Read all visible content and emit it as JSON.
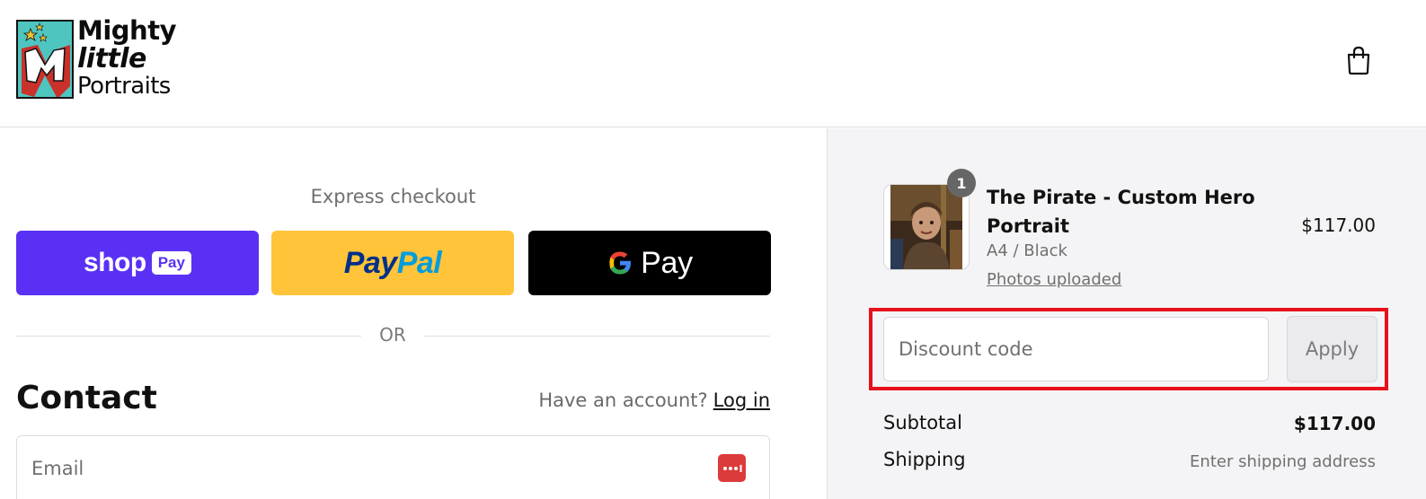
{
  "header": {
    "logo": {
      "line1": "Mighty",
      "line2": "little",
      "line3": "Portraits"
    },
    "cart_icon": "shopping-bag-icon"
  },
  "express": {
    "title": "Express checkout",
    "shop_pay": {
      "word": "shop",
      "pill": "Pay",
      "color": "#5a31f4"
    },
    "paypal": {
      "part1": "Pay",
      "part2": "Pal",
      "color": "#ffc439"
    },
    "gpay": {
      "label": "Pay",
      "color": "#000000"
    },
    "or_text": "OR"
  },
  "contact": {
    "title": "Contact",
    "account_prompt": "Have an account?",
    "login_label": "Log in",
    "email_placeholder": "Email",
    "password_manager_icon": "password-dots-icon"
  },
  "order": {
    "item": {
      "quantity": "1",
      "name": "The Pirate - Custom Hero Portrait",
      "variant": "A4 / Black",
      "link": "Photos uploaded",
      "price": "$117.00"
    },
    "discount": {
      "placeholder": "Discount code",
      "apply_label": "Apply"
    },
    "subtotal_label": "Subtotal",
    "subtotal_value": "$117.00",
    "shipping_label": "Shipping",
    "shipping_value": "Enter shipping address"
  },
  "colors": {
    "highlight": "#e8101c",
    "summary_bg": "#f4f4f6"
  }
}
